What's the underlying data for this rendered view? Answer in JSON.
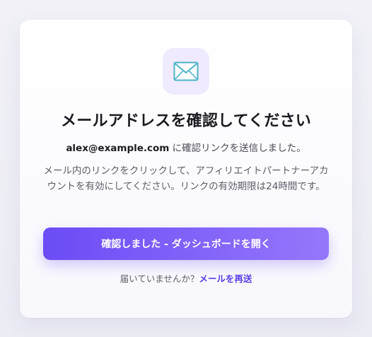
{
  "icon": "envelope-icon",
  "heading": "メールアドレスを確認してください",
  "sent_notice": {
    "email": "alex@example.com",
    "suffix": " に確認リンクを送信しました。"
  },
  "description": "メール内のリンクをクリックして、アフィリエイトパートナーアカウントを有効にしてください。リンクの有効期限は24時間です。",
  "confirm_button_label": "確認しました - ダッシュボードを開く",
  "resend": {
    "prompt": "届いていませんか？",
    "link_label": "メールを再送"
  },
  "colors": {
    "accent": "#6c4cf6",
    "accent_light": "#9577fb",
    "link": "#5b3de8",
    "icon_tile": "#efeafd"
  }
}
